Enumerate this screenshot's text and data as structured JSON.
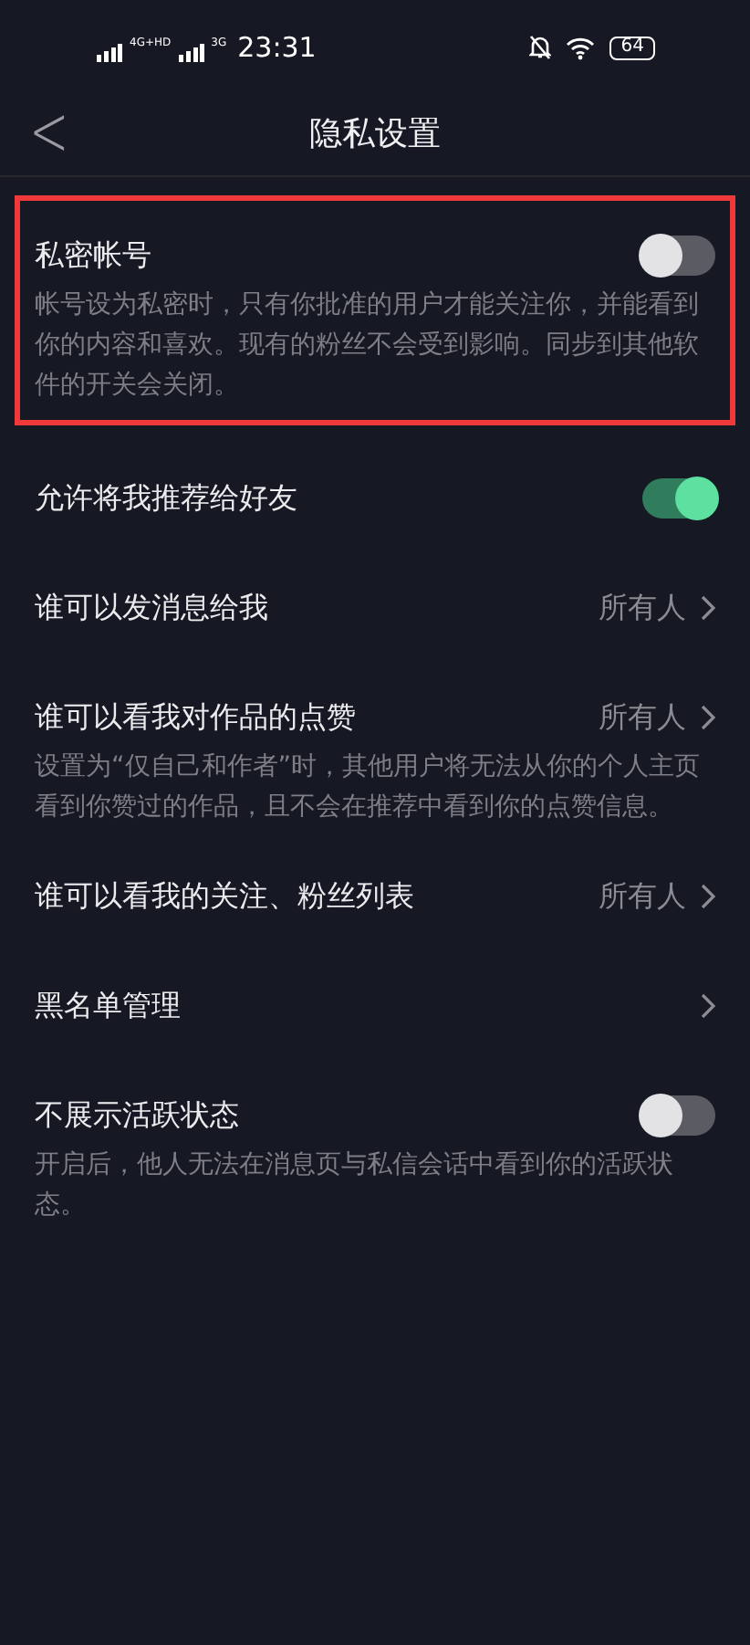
{
  "status_bar": {
    "network_1": "4G+HD",
    "network_2": "3G",
    "time": "23:31",
    "battery": "64"
  },
  "header": {
    "back": "<",
    "title": "隐私设置"
  },
  "settings": [
    {
      "kind": "toggle",
      "label": "私密帐号",
      "on": false,
      "highlighted": true,
      "description": "帐号设为私密时，只有你批准的用户才能关注你，并能看到你的内容和喜欢。现有的粉丝不会受到影响。同步到其他软件的开关会关闭。"
    },
    {
      "kind": "toggle",
      "label": "允许将我推荐给好友",
      "on": true,
      "highlighted": false
    },
    {
      "kind": "link",
      "label": "谁可以发消息给我",
      "value": "所有人",
      "highlighted": false
    },
    {
      "kind": "link",
      "label": "谁可以看我对作品的点赞",
      "value": "所有人",
      "highlighted": false,
      "description": "设置为“仅自己和作者”时，其他用户将无法从你的个人主页看到你赞过的作品，且不会在推荐中看到你的点赞信息。"
    },
    {
      "kind": "link",
      "label": "谁可以看我的关注、粉丝列表",
      "value": "所有人",
      "highlighted": false
    },
    {
      "kind": "link",
      "label": "黑名单管理",
      "highlighted": false
    },
    {
      "kind": "toggle",
      "label": "不展示活跃状态",
      "on": false,
      "highlighted": false,
      "description": "开启后，他人无法在消息页与私信会话中看到你的活跃状态。"
    }
  ]
}
